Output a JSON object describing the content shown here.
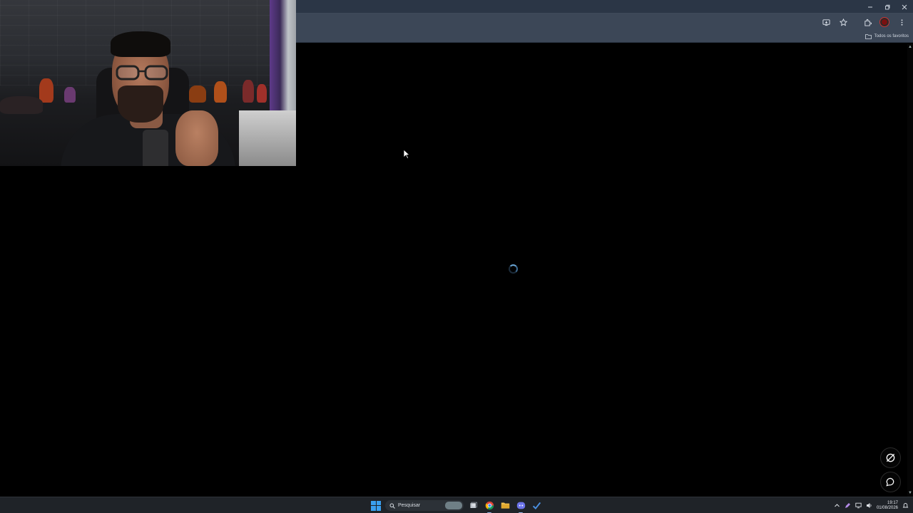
{
  "browser": {
    "bookmarks_bar": {
      "all_bookmarks_label": "Todos os favoritos"
    },
    "toolbar_icons": [
      "install-app-icon",
      "bookmark-star-icon",
      "extensions-icon",
      "profile-avatar",
      "menu-kebab-icon"
    ],
    "window_controls": [
      "minimize-icon",
      "restore-icon",
      "close-icon"
    ]
  },
  "content": {
    "state": "loading",
    "floating_buttons": [
      "no-sync-icon",
      "chat-bubble-icon"
    ]
  },
  "taskbar": {
    "search_placeholder": "Pesquisar",
    "apps": [
      "windows-start-icon",
      "task-view-icon",
      "chrome-icon",
      "file-explorer-icon",
      "discord-icon",
      "tick-app-icon"
    ],
    "clock": {
      "time": "19:17",
      "date": "01/08/2026"
    }
  },
  "colors": {
    "chrome_frame": "#2b3646",
    "chrome_toolbar": "#3c4757",
    "page_background": "#000000",
    "taskbar": "#1f2328",
    "accent": "#3aa0f0"
  }
}
